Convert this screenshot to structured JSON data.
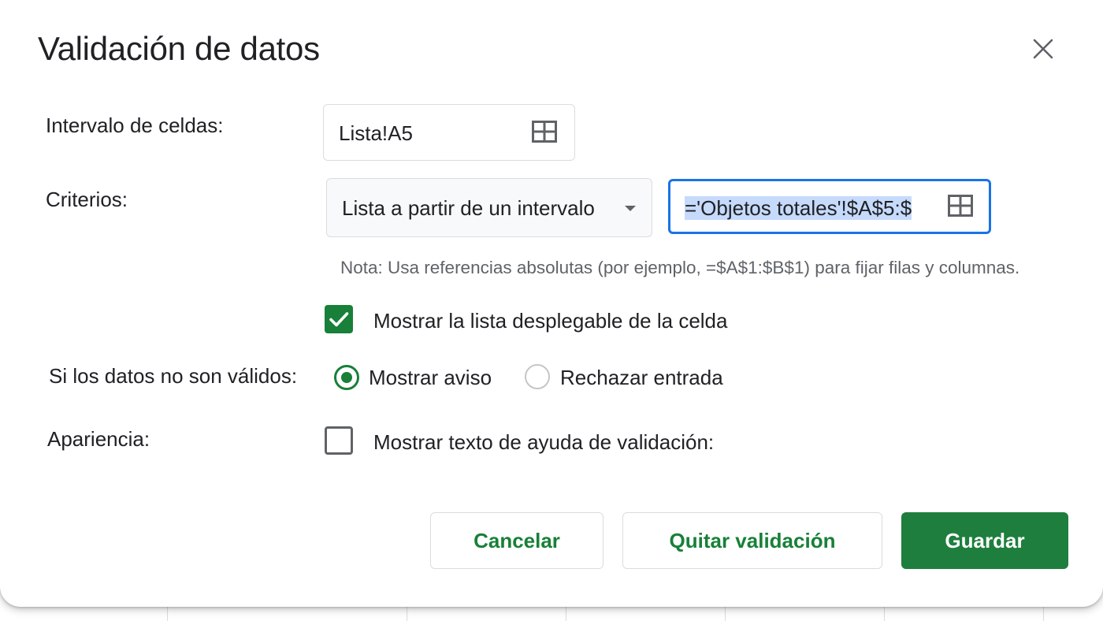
{
  "dialog": {
    "title": "Validación de datos"
  },
  "cell_range": {
    "label": "Intervalo de celdas:",
    "value": "Lista!A5",
    "icon": "grid-select-icon"
  },
  "criteria": {
    "label": "Criterios:",
    "type_selected": "Lista a partir de un intervalo",
    "range_value": "='Objetos totales'!$A$5:$",
    "note": "Nota: Usa referencias absolutas (por ejemplo, =$A$1:$B$1) para fijar filas y columnas.",
    "show_dropdown_label": "Mostrar la lista desplegable de la celda",
    "show_dropdown_checked": true
  },
  "invalid_data": {
    "label": "Si los datos no son válidos:",
    "option_warn": "Mostrar aviso",
    "option_reject": "Rechazar entrada",
    "selected": "warn"
  },
  "appearance": {
    "label": "Apariencia:",
    "help_text_label": "Mostrar texto de ayuda de validación:",
    "help_text_checked": false
  },
  "buttons": {
    "cancel": "Cancelar",
    "remove": "Quitar validación",
    "save": "Guardar"
  },
  "colors": {
    "accent_green": "#188038",
    "focus_blue": "#1a73e8",
    "selection_blue": "#c6dafc"
  }
}
